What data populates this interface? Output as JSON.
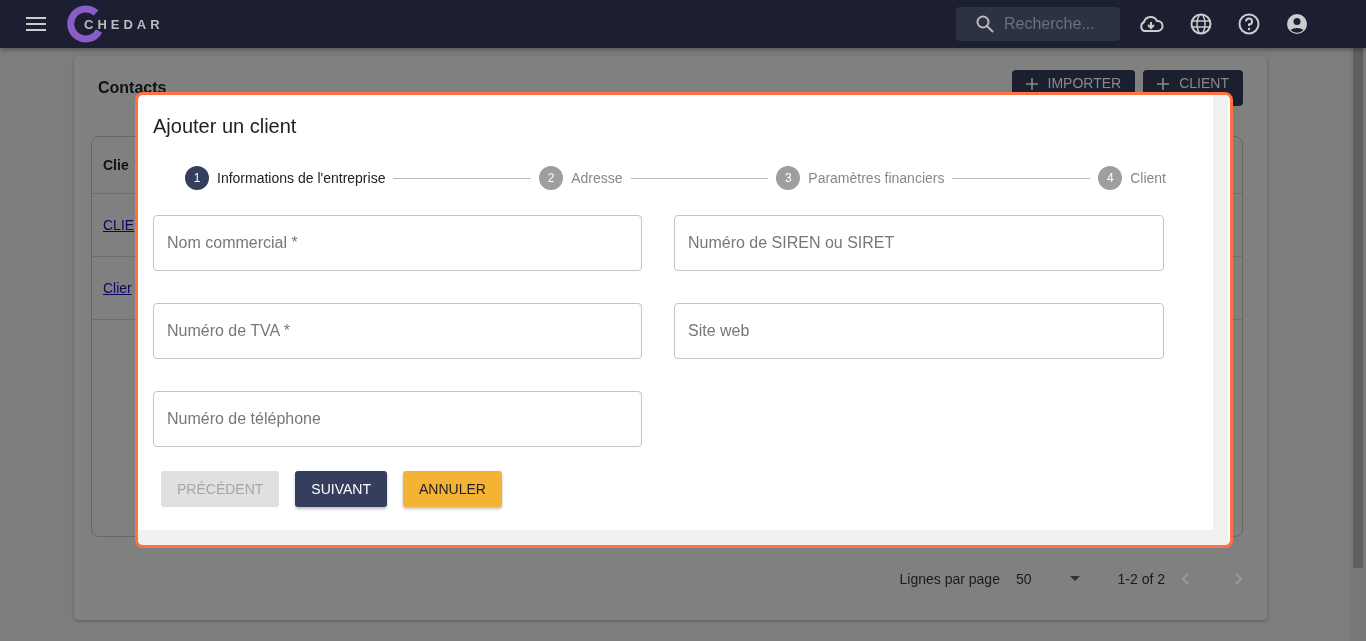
{
  "header": {
    "logo": "CHEDAR",
    "search": {
      "placeholder": "Recherche..."
    }
  },
  "page": {
    "title": "Contacts",
    "actions": [
      {
        "label": "IMPORTER"
      },
      {
        "label": "CLIENT"
      }
    ],
    "table": {
      "column_1": "Clie",
      "rows": [
        "CLIE",
        "Clier"
      ]
    },
    "pagination": {
      "rows_label": "Lignes par page",
      "rows_value": "50",
      "range": "1-2 of 2"
    }
  },
  "dialog": {
    "title": "Ajouter un client",
    "steps": [
      {
        "number": "1",
        "label": "Informations de l'entreprise",
        "selected": true
      },
      {
        "number": "2",
        "label": "Adresse",
        "selected": false
      },
      {
        "number": "3",
        "label": "Paramètres financiers",
        "selected": false
      },
      {
        "number": "4",
        "label": "Client",
        "selected": false
      }
    ],
    "fields": [
      {
        "placeholder": "Nom commercial *"
      },
      {
        "placeholder": "Numéro de SIREN ou SIRET"
      },
      {
        "placeholder": "Numéro de TVA *"
      },
      {
        "placeholder": "Site web"
      },
      {
        "placeholder": "Numéro de téléphone"
      }
    ],
    "buttons": [
      {
        "label": "PRÉCÉDENT",
        "kind": "back",
        "disabled": true
      },
      {
        "label": "SUIVANT",
        "kind": "primary",
        "disabled": false
      },
      {
        "label": "ANNULER",
        "kind": "cancel",
        "disabled": false
      }
    ]
  }
}
